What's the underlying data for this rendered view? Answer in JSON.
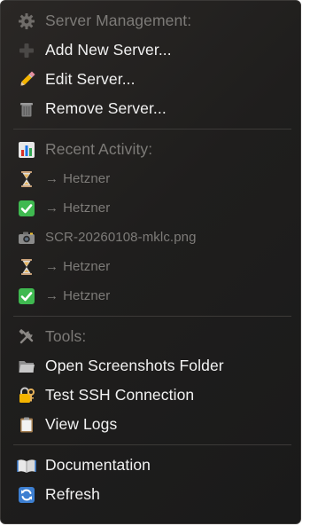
{
  "server_management": {
    "header": "Server Management:",
    "add": "Add New Server...",
    "edit": "Edit Server...",
    "remove": "Remove Server..."
  },
  "recent_activity": {
    "header": "Recent Activity:",
    "items": [
      {
        "arrow": "→",
        "label": "Hetzner",
        "icon": "hourglass-icon"
      },
      {
        "arrow": "→",
        "label": "Hetzner",
        "icon": "check-icon"
      },
      {
        "label": "SCR-20260108-mklc.png",
        "icon": "camera-icon"
      },
      {
        "arrow": "→",
        "label": "Hetzner",
        "icon": "hourglass-icon"
      },
      {
        "arrow": "→",
        "label": "Hetzner",
        "icon": "check-icon"
      }
    ]
  },
  "tools": {
    "header": "Tools:",
    "open_folder": "Open Screenshots Folder",
    "test_ssh": "Test SSH Connection",
    "view_logs": "View Logs"
  },
  "footer": {
    "documentation": "Documentation",
    "refresh": "Refresh"
  },
  "colors": {
    "menu_bg": "#1f1e1d",
    "text": "#f2f2f2",
    "disabled_text": "#7d7b78",
    "separator": "#3c3a38",
    "check_green": "#3fb950"
  }
}
